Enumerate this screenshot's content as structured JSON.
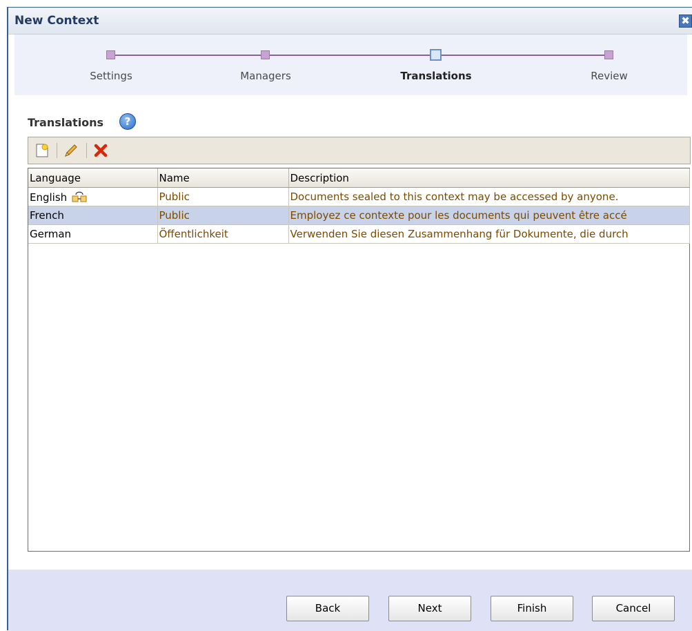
{
  "dialog": {
    "title": "New Context",
    "close_glyph": "✖"
  },
  "train": {
    "steps": [
      {
        "label": "Settings",
        "current": false
      },
      {
        "label": "Managers",
        "current": false
      },
      {
        "label": "Translations",
        "current": true
      },
      {
        "label": "Review",
        "current": false
      }
    ]
  },
  "section": {
    "title": "Translations",
    "help_glyph": "?"
  },
  "toolbar": {
    "buttons": [
      "new-icon",
      "edit-pencil-icon",
      "delete-icon"
    ]
  },
  "table": {
    "columns": [
      "Language",
      "Name",
      "Description"
    ],
    "rows": [
      {
        "language": "English",
        "name": "Public",
        "description": "Documents sealed to this context may be accessed by anyone.",
        "selected": false,
        "translate_icon": true
      },
      {
        "language": "French",
        "name": "Public",
        "description": "Employez ce contexte pour les documents qui peuvent être accé",
        "selected": true
      },
      {
        "language": "German",
        "name": "Öffentlichkeit",
        "description": "Verwenden Sie diesen Zusammenhang für Dokumente, die durch",
        "selected": false
      }
    ]
  },
  "footer": {
    "back": "Back",
    "next": "Next",
    "finish": "Finish",
    "cancel": "Cancel"
  },
  "colors": {
    "train_background": "#eef0fa",
    "footer_background": "#dfe2f6",
    "selected_row": "#c8d2e8"
  }
}
